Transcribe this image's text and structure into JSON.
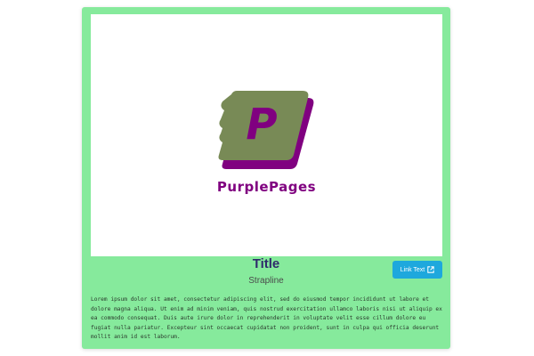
{
  "card": {
    "background_color": "#86ea9c",
    "logo": {
      "wordmark": "PurplePages",
      "letter": "P",
      "brand_color": "#800080",
      "book_color": "#788a56"
    },
    "title": "Title",
    "strapline": "Strapline",
    "link_button": {
      "label": "Link Text",
      "icon": "external-link-icon",
      "color": "#1ea8dd"
    },
    "body": "Lorem ipsum dolor sit amet, consectetur adipiscing elit, sed do eiusmod tempor incididunt ut labore et dolore magna aliqua. Ut enim ad minim veniam, quis nostrud exercitation ullamco laboris nisi ut aliquip ex ea commodo consequat. Duis aute irure dolor in reprehenderit in voluptate velit esse cillum dolore eu fugiat nulla pariatur. Excepteur sint occaecat cupidatat non proident, sunt in culpa qui officia deserunt mollit anim id est laborum."
  }
}
